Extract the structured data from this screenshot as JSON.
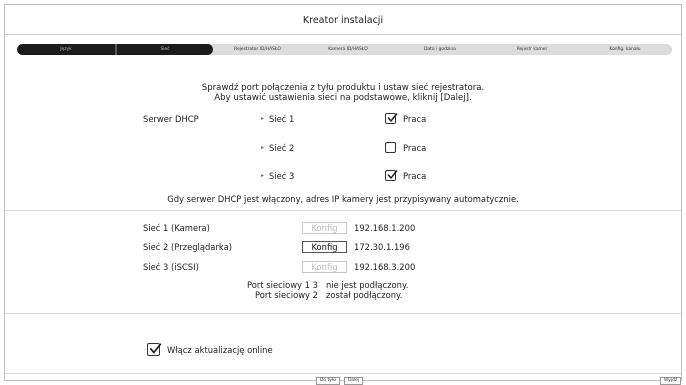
{
  "window": {
    "title": "Kreator instalacji"
  },
  "steps": [
    "Język",
    "Sieć",
    "Rejestrator ID/HASŁO",
    "Kamera ID/HASŁO",
    "Data i godzina",
    "Rejestr kamer",
    "Konfig. kanału"
  ],
  "intro": {
    "line1": "Sprawdź port połączenia z tyłu produktu i ustaw sieć rejestratora.",
    "line2": "Aby ustawić ustawienia sieci na podstawowe, kliknij [Dalej]."
  },
  "dhcp": {
    "label": "Serwer DHCP",
    "rows": [
      {
        "name": "Sieć 1",
        "checked": true,
        "option": "Praca"
      },
      {
        "name": "Sieć 2",
        "checked": false,
        "option": "Praca"
      },
      {
        "name": "Sieć 3",
        "checked": true,
        "option": "Praca"
      }
    ],
    "note": "Gdy serwer DHCP jest włączony, adres IP kamery jest przypisywany automatycznie."
  },
  "networks": [
    {
      "name": "Sieć 1 (Kamera)",
      "button": "Konfig",
      "enabled": false,
      "ip": "192.168.1.200"
    },
    {
      "name": "Sieć 2 (Przeglądarka)",
      "button": "Konfig",
      "enabled": true,
      "ip": "172.30.1.196"
    },
    {
      "name": "Sieć 3 (iSCSI)",
      "button": "Konfig",
      "enabled": false,
      "ip": "192.168.3.200"
    }
  ],
  "ports": {
    "line1_label": "Port sieciowy 1 3",
    "line1_status": "nie jest podłączony.",
    "line2_label": "Port sieciowy 2",
    "line2_status": "został podłączony."
  },
  "online_update": {
    "label": "Włącz aktualizację online",
    "checked": true
  },
  "footer": {
    "back": "Do tyłu",
    "next": "Dalej",
    "exit": "Wyjdź"
  }
}
